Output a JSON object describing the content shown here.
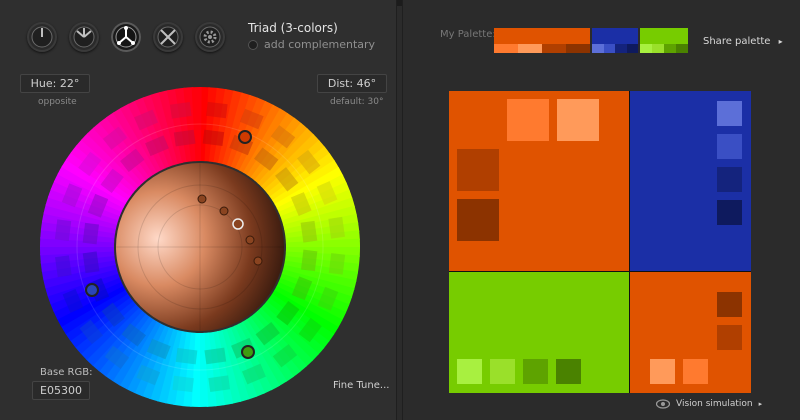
{
  "scheme": {
    "title": "Triad (3-colors)",
    "add_complementary": "add complementary"
  },
  "hue": {
    "label": "Hue: 22°",
    "sub": "opposite"
  },
  "dist": {
    "label": "Dist: 46°",
    "sub": "default: 30°"
  },
  "base": {
    "label": "Base RGB:",
    "value": "E05300"
  },
  "fine_tune": "Fine Tune...",
  "palette": {
    "label": "My Palette:",
    "share": "Share palette",
    "share_arrow": "▸",
    "groups": [
      {
        "name": "orange",
        "main": "#E05300",
        "shades": [
          "#FF7A2F",
          "#FF9A5A",
          "#B03F00",
          "#8C3300"
        ]
      },
      {
        "name": "blue",
        "main": "#1B2FA6",
        "shades": [
          "#5C6FD8",
          "#3A4FC4",
          "#14237D",
          "#0E1A5E"
        ]
      },
      {
        "name": "green",
        "main": "#77CC00",
        "shades": [
          "#A8F040",
          "#9AE02A",
          "#5EA300",
          "#4A8200"
        ]
      }
    ]
  },
  "vision": {
    "label": "Vision simulation",
    "arrow": "▸"
  },
  "colors": {
    "bg": "#2b2b2b",
    "panel": "#2f2f2f",
    "text": "#cfcfcf"
  }
}
